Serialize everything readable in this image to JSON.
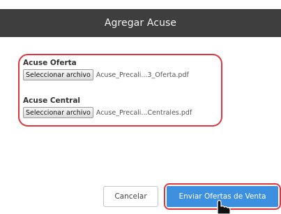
{
  "dialog": {
    "title": "Agregar Acuse"
  },
  "fields": [
    {
      "label": "Acuse Oferta",
      "button_label": "Seleccionar archivo",
      "file_name": "Acuse_Precali...3_Oferta.pdf"
    },
    {
      "label": "Acuse Central",
      "button_label": "Seleccionar archivo",
      "file_name": "Acuse_Precali...Centrales.pdf"
    }
  ],
  "footer": {
    "cancel_label": "Cancelar",
    "submit_label": "Enviar Ofertas de Venta"
  },
  "colors": {
    "header_bg": "#3e3e3e",
    "primary": "#3d8fe0",
    "highlight": "#e0353c"
  },
  "icons": {
    "cursor": "hand-pointer-icon"
  }
}
